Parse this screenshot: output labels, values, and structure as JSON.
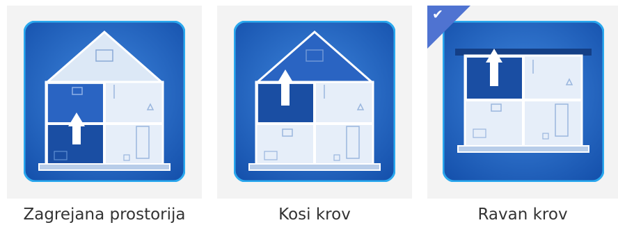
{
  "options": [
    {
      "id": "heated-room",
      "label": "Zagrejana prostorija",
      "selected": false,
      "icon": "house-heated-room-icon"
    },
    {
      "id": "pitched-roof",
      "label": "Kosi krov",
      "selected": false,
      "icon": "house-pitched-roof-icon"
    },
    {
      "id": "flat-roof",
      "label": "Ravan krov",
      "selected": true,
      "icon": "house-flat-roof-icon"
    }
  ],
  "selected_badge_icon": "checkmark-icon",
  "colors": {
    "tile_blue": "#1f5fbf",
    "tile_border": "#2aa8ee",
    "highlight_room": "#1d52a8",
    "badge": "#4f73d1",
    "caption_text": "#333333"
  }
}
